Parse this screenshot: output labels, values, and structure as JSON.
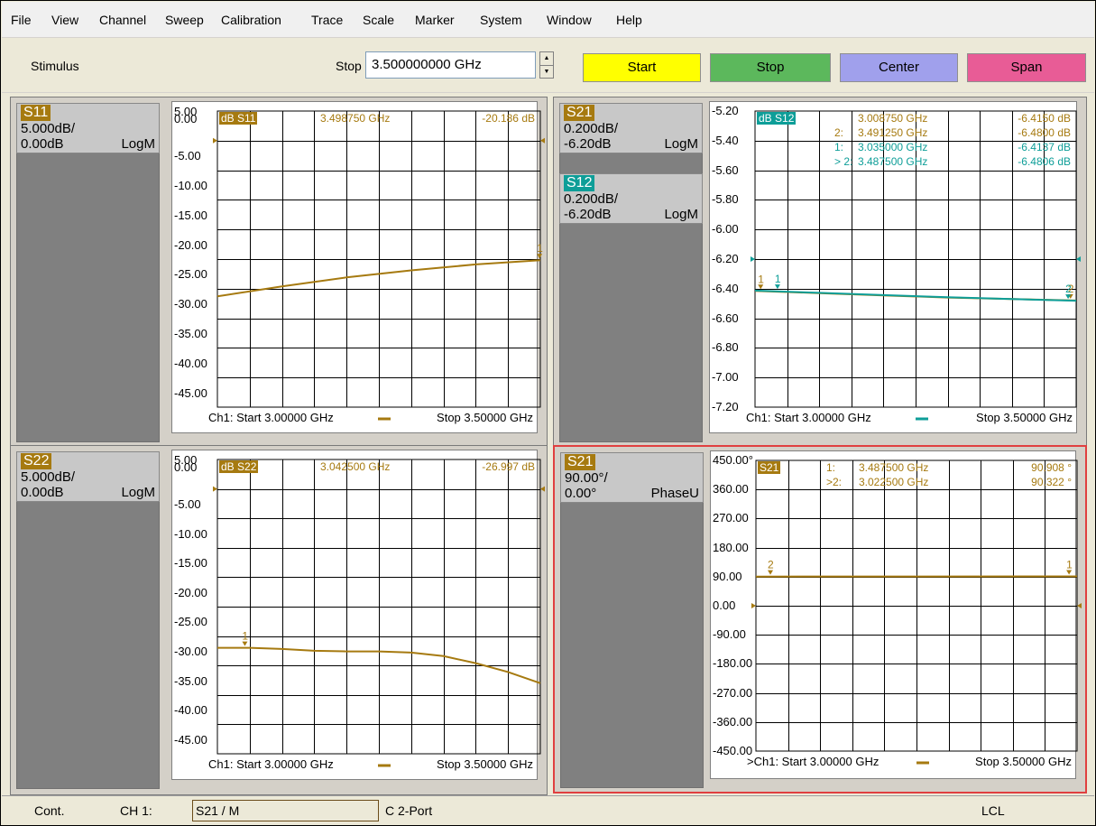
{
  "colors": {
    "gold": "#a67a10",
    "teal": "#0e9e98",
    "active_border": "#e04040",
    "start_btn": "#ffff00",
    "stop_btn": "#5cb85c",
    "center_btn": "#a0a0ec",
    "span_btn": "#e85c96"
  },
  "menu": [
    "File",
    "View",
    "Channel",
    "Sweep",
    "Calibration",
    "Trace",
    "Scale",
    "Marker",
    "System",
    "Window",
    "Help"
  ],
  "toolbar": {
    "section": "Stimulus",
    "stop_label": "Stop",
    "stop_value": "3.500000000 GHz",
    "buttons": [
      "Start",
      "Stop",
      "Center",
      "Span"
    ]
  },
  "windows": [
    {
      "traces": [
        {
          "name": "S11",
          "scale": "5.000dB/",
          "ref": "0.00dB",
          "format": "LogM",
          "color": "gold"
        }
      ],
      "header": {
        "tag": "dB S11",
        "color": "gold"
      },
      "marker_readouts": [
        {
          "label": "",
          "freq": "3.498750 GHz",
          "value": "-20.186 dB",
          "color": "gold"
        }
      ],
      "y_labels": [
        "5.00",
        "0.00",
        "-5.00",
        "-10.00",
        "-15.00",
        "-20.00",
        "-25.00",
        "-30.00",
        "-35.00",
        "-40.00",
        "-45.00"
      ],
      "y_range": [
        -45,
        5
      ],
      "footer": {
        "left": "Ch1: Start 3.00000 GHz",
        "right": "Stop 3.50000 GHz"
      },
      "traces_data": [
        {
          "color": "gold",
          "x": [
            3.0,
            3.1,
            3.2,
            3.3,
            3.4,
            3.5
          ],
          "y": [
            -26.3,
            -24.6,
            -23.1,
            -21.9,
            -20.9,
            -20.2
          ]
        }
      ],
      "markers": [
        {
          "label": "1",
          "x": 3.49875,
          "y": -20.19,
          "color": "gold"
        }
      ]
    },
    {
      "traces": [
        {
          "name": "S21",
          "scale": "0.200dB/",
          "ref": "-6.20dB",
          "format": "LogM",
          "color": "gold"
        },
        {
          "name": "S12",
          "scale": "0.200dB/",
          "ref": "-6.20dB",
          "format": "LogM",
          "color": "teal"
        }
      ],
      "header": {
        "tag": "dB S12",
        "color": "teal"
      },
      "marker_readouts": [
        {
          "label": "",
          "freq": "3.008750 GHz",
          "value": "-6.4150 dB",
          "color": "gold"
        },
        {
          "label": "2:",
          "freq": "3.491250 GHz",
          "value": "-6.4800 dB",
          "color": "gold"
        },
        {
          "label": "1:",
          "freq": "3.035000 GHz",
          "value": "-6.4137 dB",
          "color": "teal"
        },
        {
          "label": "> 2:",
          "freq": "3.487500 GHz",
          "value": "-6.4806 dB",
          "color": "teal"
        }
      ],
      "y_labels": [
        "-5.20",
        "-5.40",
        "-5.60",
        "-5.80",
        "-6.00",
        "-6.20",
        "-6.40",
        "-6.60",
        "-6.80",
        "-7.00",
        "-7.20"
      ],
      "y_range": [
        -7.2,
        -5.2
      ],
      "footer": {
        "left": "Ch1: Start 3.00000 GHz",
        "right": "Stop 3.50000 GHz"
      },
      "traces_data": [
        {
          "color": "gold",
          "x": [
            3.0,
            3.1,
            3.2,
            3.3,
            3.4,
            3.5
          ],
          "y": [
            -6.415,
            -6.43,
            -6.445,
            -6.46,
            -6.47,
            -6.48
          ]
        },
        {
          "color": "teal",
          "x": [
            3.0,
            3.1,
            3.2,
            3.3,
            3.4,
            3.5
          ],
          "y": [
            -6.413,
            -6.428,
            -6.443,
            -6.458,
            -6.47,
            -6.481
          ]
        }
      ],
      "markers": [
        {
          "label": "1",
          "x": 3.00875,
          "y": -6.415,
          "color": "gold"
        },
        {
          "label": "1",
          "x": 3.035,
          "y": -6.414,
          "color": "teal"
        },
        {
          "label": "2",
          "x": 3.49125,
          "y": -6.48,
          "color": "gold"
        },
        {
          "label": "2",
          "x": 3.4875,
          "y": -6.481,
          "color": "teal"
        }
      ]
    },
    {
      "traces": [
        {
          "name": "S22",
          "scale": "5.000dB/",
          "ref": "0.00dB",
          "format": "LogM",
          "color": "gold"
        }
      ],
      "header": {
        "tag": "dB S22",
        "color": "gold"
      },
      "marker_readouts": [
        {
          "label": "",
          "freq": "3.042500 GHz",
          "value": "-26.997 dB",
          "color": "gold"
        }
      ],
      "y_labels": [
        "5.00",
        "0.00",
        "-5.00",
        "-10.00",
        "-15.00",
        "-20.00",
        "-25.00",
        "-30.00",
        "-35.00",
        "-40.00",
        "-45.00"
      ],
      "y_range": [
        -45,
        5
      ],
      "footer": {
        "left": "Ch1: Start 3.00000 GHz",
        "right": "Stop 3.50000 GHz"
      },
      "traces_data": [
        {
          "color": "gold",
          "x": [
            3.0,
            3.05,
            3.1,
            3.15,
            3.2,
            3.25,
            3.3,
            3.35,
            3.4,
            3.45,
            3.5
          ],
          "y": [
            -27.0,
            -27.0,
            -27.2,
            -27.5,
            -27.6,
            -27.6,
            -27.8,
            -28.4,
            -29.6,
            -31.1,
            -33.0
          ]
        }
      ],
      "markers": [
        {
          "label": "1",
          "x": 3.0425,
          "y": -27.0,
          "color": "gold"
        }
      ]
    },
    {
      "active": true,
      "traces": [
        {
          "name": "S21",
          "scale": "90.00°/",
          "ref": "0.00°",
          "format": "PhaseU",
          "color": "gold"
        }
      ],
      "header": {
        "tag": "S21",
        "color": "gold"
      },
      "marker_readouts": [
        {
          "label": "1:",
          "freq": "3.487500 GHz",
          "value": "90.908 °",
          "color": "gold"
        },
        {
          "label": ">2:",
          "freq": "3.022500 GHz",
          "value": "90.322 °",
          "color": "gold"
        }
      ],
      "y_labels": [
        "450.00°",
        "360.00",
        "270.00",
        "180.00",
        "90.00",
        "0.00",
        "-90.00",
        "-180.00",
        "-270.00",
        "-360.00",
        "-450.00"
      ],
      "y_range": [
        -450,
        450
      ],
      "footer": {
        "left": ">Ch1: Start 3.00000 GHz",
        "right": "Stop 3.50000 GHz"
      },
      "traces_data": [
        {
          "color": "gold",
          "x": [
            3.0,
            3.5
          ],
          "y": [
            90.3,
            90.9
          ]
        }
      ],
      "markers": [
        {
          "label": "2",
          "x": 3.0225,
          "y": 90.32,
          "color": "gold"
        },
        {
          "label": "1",
          "x": 3.4875,
          "y": 90.91,
          "color": "gold"
        }
      ]
    }
  ],
  "status": {
    "mode": "Cont.",
    "channel": "CH 1:",
    "active_trace": "S21 / M",
    "port": "C  2-Port",
    "remote": "LCL"
  }
}
